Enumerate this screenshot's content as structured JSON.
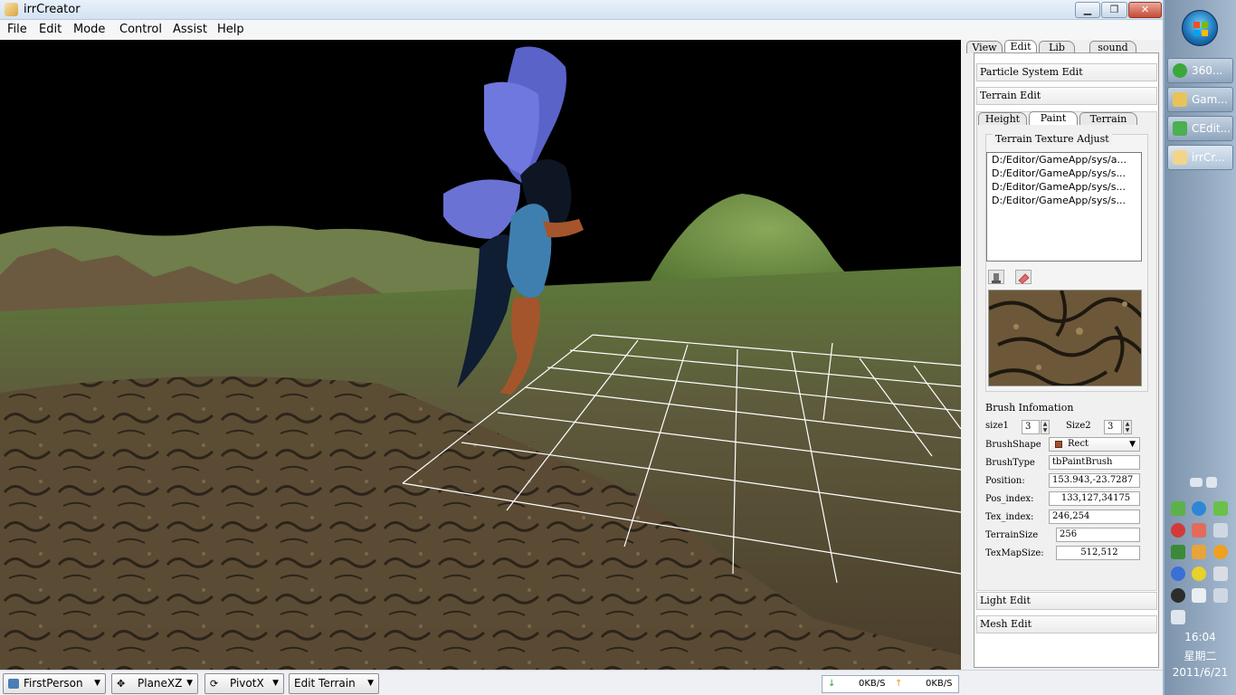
{
  "window": {
    "title": "irrCreator",
    "min_label": "▁",
    "max_label": "❐",
    "close_label": "✕"
  },
  "menu": [
    "File",
    "Edit",
    "Mode",
    "Control",
    "Assist",
    "Help"
  ],
  "panel": {
    "top_tabs": [
      "View",
      "Edit",
      "Lib",
      "sound"
    ],
    "active_top_tab": "Edit",
    "sections": {
      "particle": "Particle System Edit",
      "terrain": "Terrain Edit",
      "light": "Light Edit",
      "mesh": "Mesh Edit"
    },
    "terrain_tabs": [
      "Height",
      "Paint",
      "Terrain"
    ],
    "active_terrain_tab": "Paint",
    "texture_group_title": "Terrain Texture Adjust",
    "texture_list": [
      "D:/Editor/GameApp/sys/a...",
      "D:/Editor/GameApp/sys/s...",
      "D:/Editor/GameApp/sys/s...",
      "D:/Editor/GameApp/sys/s..."
    ],
    "brush": {
      "title": "Brush Infomation",
      "size1_label": "size1",
      "size1": "3",
      "size2_label": "Size2",
      "size2": "3",
      "shape_label": "BrushShape",
      "shape": "Rect",
      "type_label": "BrushType",
      "type": "tbPaintBrush",
      "position_label": "Position:",
      "position": "153.943,-23.7287",
      "pos_index_label": "Pos_index:",
      "pos_index": "133,127,34175",
      "tex_index_label": "Tex_index:",
      "tex_index": "246,254",
      "terrain_size_label": "TerrainSize",
      "terrain_size": "256",
      "texmap_size_label": "TexMapSize:",
      "texmap_size": "512,512"
    }
  },
  "statusbar": {
    "camera": "FirstPerson",
    "plane": "PlaneXZ",
    "pivot": "PivotX",
    "mode": "Edit Terrain",
    "down_speed": "0KB/S",
    "up_speed": "0KB/S"
  },
  "taskbar": {
    "buttons": [
      "360...",
      "Gam...",
      "CEdit...",
      "irrCr..."
    ],
    "time": "16:04",
    "weekday": "星期二",
    "date": "2011/6/21"
  },
  "colors": {
    "sky": "#000000",
    "grass": "#5f8a3a",
    "ground": "#5a4a32",
    "grid": "#ffffff",
    "fairy_wing": "#6a70d8",
    "fairy_dress": "#3f7fb0"
  }
}
